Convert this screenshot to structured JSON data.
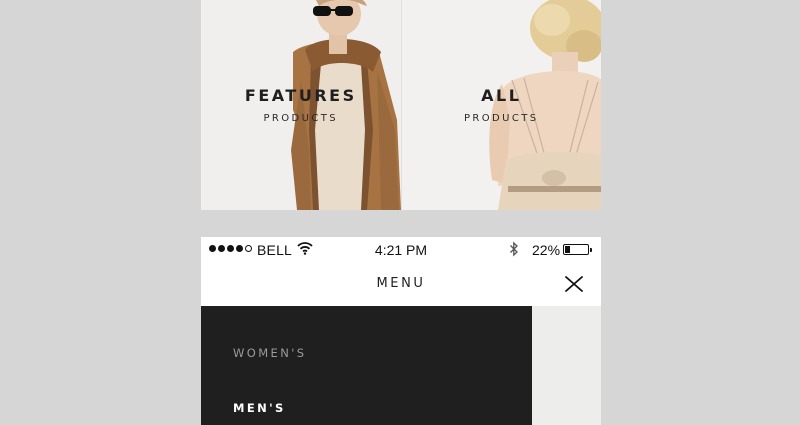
{
  "tiles": [
    {
      "title": "FEATURES",
      "subtitle": "PRODUCTS"
    },
    {
      "title": "ALL",
      "subtitle": "PRODUCTS"
    }
  ],
  "status_bar": {
    "carrier": "BELL",
    "time": "4:21 PM",
    "battery": "22%",
    "battery_level": 0.22,
    "signal_bars_filled": 4,
    "signal_bars_total": 5
  },
  "nav": {
    "title": "MENU",
    "close_icon": "close-icon"
  },
  "menu": {
    "items": [
      {
        "label": "WOMEN'S",
        "active": false
      },
      {
        "label": "MEN'S",
        "active": true
      }
    ]
  },
  "colors": {
    "background": "#d6d6d6",
    "menu_panel": "#1f1f1f",
    "menu_text_muted": "#9a9a9a",
    "menu_text_active": "#ffffff"
  }
}
